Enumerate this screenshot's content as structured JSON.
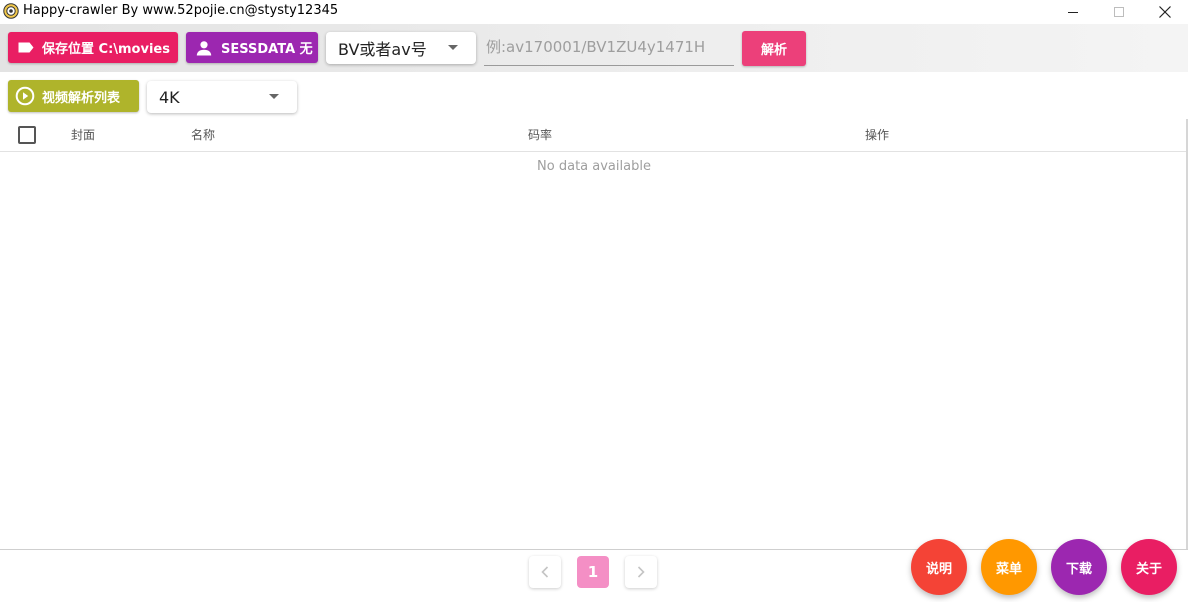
{
  "window": {
    "title": "Happy-crawler By www.52pojie.cn@stysty12345"
  },
  "toolbar": {
    "save_location_label": "保存位置 C:\\movies",
    "sessdata_label": "SESSDATA 无",
    "id_type_select": "BV或者av号",
    "id_input_value": "",
    "id_input_placeholder": "例:av170001/BV1ZU4y1471H",
    "parse_button_label": "解析"
  },
  "subbar": {
    "video_list_button_label": "视频解析列表",
    "quality_select": "4K"
  },
  "table": {
    "columns": [
      "封面",
      "名称",
      "码率",
      "操作"
    ],
    "rows": [],
    "empty_text": "No data available"
  },
  "pagination": {
    "current_page": "1"
  },
  "fabs": {
    "help": "说明",
    "menu": "菜单",
    "download": "下载",
    "about": "关于"
  },
  "colors": {
    "save_button": "#e91e63",
    "sessdata_button": "#9c27b0",
    "parse_button": "#ec407a",
    "video_list_button": "#afb42b",
    "fab_help": "#f44336",
    "fab_menu": "#ff9800",
    "fab_download": "#9c27b0",
    "fab_about": "#e91e63",
    "page_active": "#f48fc5"
  },
  "icons": {
    "app": "app-logo-icon",
    "save": "label-tag-icon",
    "sessdata": "user-icon",
    "video_list": "play-circle-icon",
    "prev": "chevron-left-icon",
    "next": "chevron-right-icon"
  }
}
